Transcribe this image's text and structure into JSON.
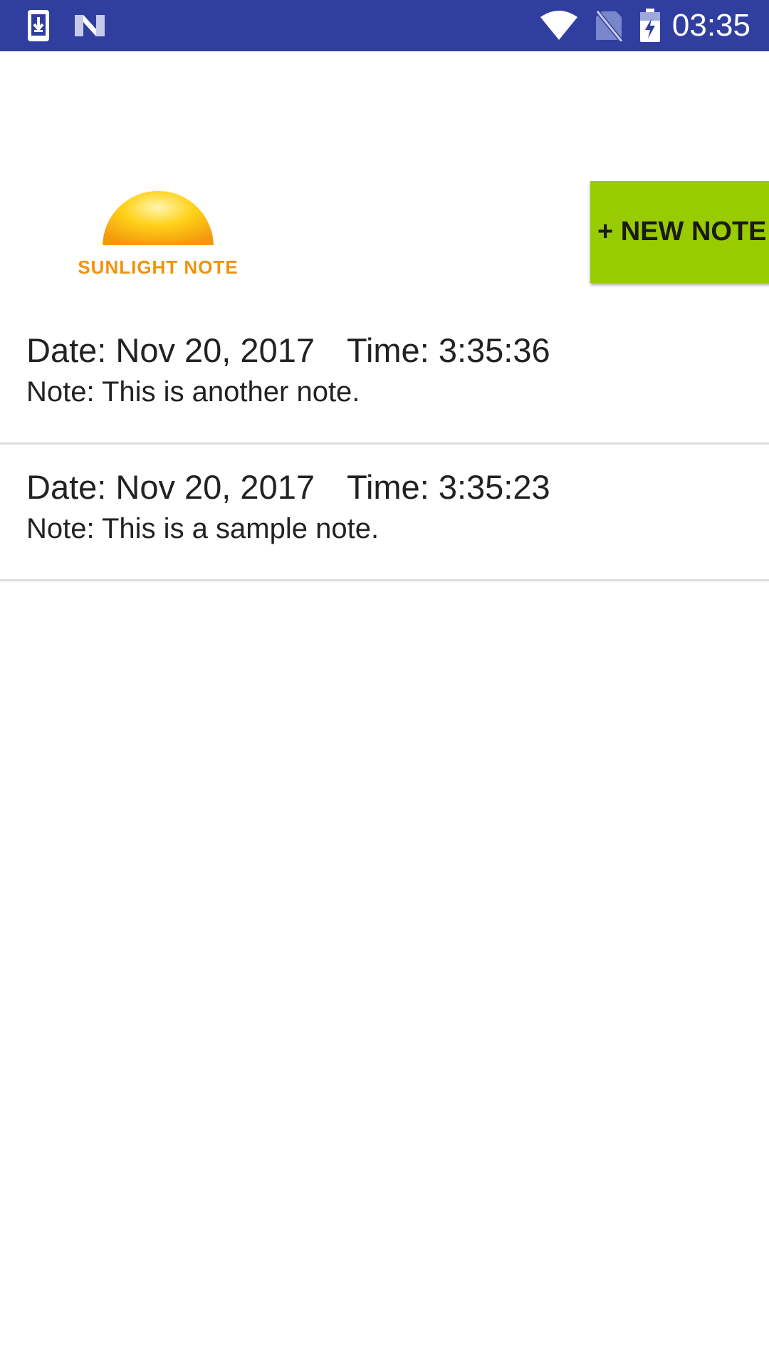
{
  "status_bar": {
    "time": "03:35",
    "background_color": "#303f9f",
    "left_icons": [
      "download-notification-icon",
      "n-logo-icon"
    ],
    "right_icons": [
      "wifi-icon",
      "no-sim-icon",
      "battery-charging-icon"
    ]
  },
  "header": {
    "logo_text": "SUNLIGHT NOTE",
    "new_note_label": "+ NEW NOTE",
    "new_note_color": "#99cc00"
  },
  "notes": [
    {
      "date": "Date: Nov 20, 2017",
      "time": "Time: 3:35:36",
      "note": "Note: This is another note."
    },
    {
      "date": "Date: Nov 20, 2017",
      "time": "Time: 3:35:23",
      "note": "Note: This is a sample note."
    }
  ]
}
